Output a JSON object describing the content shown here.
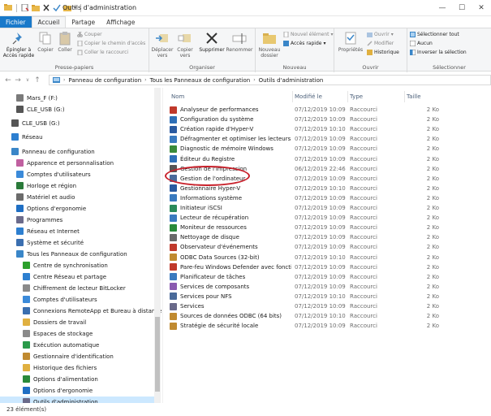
{
  "window": {
    "title": "Outils d'administration",
    "controls": [
      "—",
      "☐",
      "✕"
    ]
  },
  "tabs": [
    "Fichier",
    "Accueil",
    "Partage",
    "Affichage"
  ],
  "ribbon": {
    "presse_papiers": {
      "label": "Presse-papiers",
      "pin": "Épingler à\nAccès rapide",
      "copy": "Copier",
      "paste": "Coller",
      "cut": "Couper",
      "copy_path": "Copier le chemin d'accès",
      "paste_shortcut": "Coller le raccourci"
    },
    "organiser": {
      "label": "Organiser",
      "move": "Déplacer\nvers",
      "copy_to": "Copier\nvers",
      "delete": "Supprimer",
      "rename": "Renommer"
    },
    "nouveau": {
      "label": "Nouveau",
      "new_folder": "Nouveau\ndossier",
      "new_item": "Nouvel élément",
      "easy_access": "Accès rapide"
    },
    "ouvrir": {
      "label": "Ouvrir",
      "properties": "Propriétés",
      "open": "Ouvrir",
      "edit": "Modifier",
      "history": "Historique"
    },
    "selectionner": {
      "label": "Sélectionner",
      "select_all": "Sélectionner tout",
      "select_none": "Aucun",
      "invert": "Inverser la sélection"
    }
  },
  "address": {
    "crumbs": [
      "Panneau de configuration",
      "Tous les Panneaux de configuration",
      "Outils d'administration"
    ]
  },
  "nav": [
    {
      "label": "Mars_F (F:)",
      "indent": 20,
      "icon": "drive",
      "color": "#7a7a7a"
    },
    {
      "label": "CLE_USB (G:)",
      "indent": 20,
      "icon": "usb-drive",
      "color": "#555555"
    },
    {
      "label": "CLE_USB (G:)",
      "indent": 14,
      "icon": "usb-drive",
      "color": "#555555"
    },
    {
      "label": "Réseau",
      "indent": 14,
      "icon": "network",
      "color": "#2d7fd0"
    },
    {
      "label": "Panneau de configuration",
      "indent": 14,
      "icon": "control-panel",
      "color": "#3a86c8"
    },
    {
      "label": "Apparence et personnalisation",
      "indent": 20,
      "icon": "appearance",
      "color": "#c060a0"
    },
    {
      "label": "Comptes d'utilisateurs",
      "indent": 20,
      "icon": "users",
      "color": "#3b8ad9"
    },
    {
      "label": "Horloge et région",
      "indent": 20,
      "icon": "clock",
      "color": "#2a7a3a"
    },
    {
      "label": "Matériel et audio",
      "indent": 20,
      "icon": "hardware",
      "color": "#6b6b6b"
    },
    {
      "label": "Options d'ergonomie",
      "indent": 20,
      "icon": "ease-of-access",
      "color": "#1f6fc4"
    },
    {
      "label": "Programmes",
      "indent": 20,
      "icon": "programs",
      "color": "#6b6b8b"
    },
    {
      "label": "Réseau et Internet",
      "indent": 20,
      "icon": "network-internet",
      "color": "#2d7fd0"
    },
    {
      "label": "Système et sécurité",
      "indent": 20,
      "icon": "system-security",
      "color": "#3b6fb0"
    },
    {
      "label": "Tous les Panneaux de configuration",
      "indent": 20,
      "icon": "control-panel",
      "color": "#3a86c8"
    },
    {
      "label": "Centre de synchronisation",
      "indent": 28,
      "icon": "sync",
      "color": "#2ca02c"
    },
    {
      "label": "Centre Réseau et partage",
      "indent": 28,
      "icon": "network-sharing",
      "color": "#2d7fd0"
    },
    {
      "label": "Chiffrement de lecteur BitLocker",
      "indent": 28,
      "icon": "bitlocker",
      "color": "#8a8a8a"
    },
    {
      "label": "Comptes d'utilisateurs",
      "indent": 28,
      "icon": "users",
      "color": "#3b8ad9"
    },
    {
      "label": "Connexions RemoteApp et Bureau à distance",
      "indent": 28,
      "icon": "remoteapp",
      "color": "#3a6fb0"
    },
    {
      "label": "Dossiers de travail",
      "indent": 28,
      "icon": "work-folders",
      "color": "#e0b040"
    },
    {
      "label": "Espaces de stockage",
      "indent": 28,
      "icon": "storage-spaces",
      "color": "#8a8a8a"
    },
    {
      "label": "Exécution automatique",
      "indent": 28,
      "icon": "autoplay",
      "color": "#2a9a4a"
    },
    {
      "label": "Gestionnaire d'identification",
      "indent": 28,
      "icon": "credential-manager",
      "color": "#c08a30"
    },
    {
      "label": "Historique des fichiers",
      "indent": 28,
      "icon": "file-history",
      "color": "#e0b040"
    },
    {
      "label": "Options d'alimentation",
      "indent": 28,
      "icon": "power",
      "color": "#2a8a3a"
    },
    {
      "label": "Options d'ergonomie",
      "indent": 28,
      "icon": "ease-of-access",
      "color": "#1f6fc4"
    },
    {
      "label": "Outils d'administration",
      "indent": 28,
      "icon": "admin-tools",
      "color": "#6a6a8a",
      "selected": true
    }
  ],
  "columns": {
    "name": "Nom",
    "date": "Modifié le",
    "type": "Type",
    "size": "Taille"
  },
  "files": [
    {
      "name": "Analyseur de performances",
      "date": "07/12/2019 10:09",
      "type": "Raccourci",
      "size": "2 Ko",
      "icon": "perfmon",
      "color": "#c0392b"
    },
    {
      "name": "Configuration du système",
      "date": "07/12/2019 10:09",
      "type": "Raccourci",
      "size": "2 Ko",
      "icon": "msconfig",
      "color": "#2e6fb7"
    },
    {
      "name": "Création rapide d'Hyper-V",
      "date": "07/12/2019 10:10",
      "type": "Raccourci",
      "size": "2 Ko",
      "icon": "hyperv",
      "color": "#2a5aa0"
    },
    {
      "name": "Défragmenter et optimiser les lecteurs",
      "date": "07/12/2019 10:09",
      "type": "Raccourci",
      "size": "2 Ko",
      "icon": "defrag",
      "color": "#3a7abf"
    },
    {
      "name": "Diagnostic de mémoire Windows",
      "date": "07/12/2019 10:09",
      "type": "Raccourci",
      "size": "2 Ko",
      "icon": "memory-diagnostic",
      "color": "#3a8a3a"
    },
    {
      "name": "Éditeur du Registre",
      "date": "07/12/2019 10:09",
      "type": "Raccourci",
      "size": "2 Ko",
      "icon": "regedit",
      "color": "#2e6fb7"
    },
    {
      "name": "Gestion de l'impression",
      "date": "06/12/2019 22:46",
      "type": "Raccourci",
      "size": "2 Ko",
      "icon": "print-management",
      "color": "#555555"
    },
    {
      "name": "Gestion de l'ordinateur",
      "date": "07/12/2019 10:09",
      "type": "Raccourci",
      "size": "2 Ko",
      "icon": "computer-management",
      "color": "#4a6a9a"
    },
    {
      "name": "Gestionnaire Hyper-V",
      "date": "07/12/2019 10:10",
      "type": "Raccourci",
      "size": "2 Ko",
      "icon": "hyperv",
      "color": "#2a5aa0"
    },
    {
      "name": "Informations système",
      "date": "07/12/2019 10:09",
      "type": "Raccourci",
      "size": "2 Ko",
      "icon": "system-info",
      "color": "#3a7abf"
    },
    {
      "name": "Initiateur iSCSI",
      "date": "07/12/2019 10:09",
      "type": "Raccourci",
      "size": "2 Ko",
      "icon": "iscsi",
      "color": "#2a8a5a"
    },
    {
      "name": "Lecteur de récupération",
      "date": "07/12/2019 10:09",
      "type": "Raccourci",
      "size": "2 Ko",
      "icon": "recovery-drive",
      "color": "#3a7abf"
    },
    {
      "name": "Moniteur de ressources",
      "date": "07/12/2019 10:09",
      "type": "Raccourci",
      "size": "2 Ko",
      "icon": "resmon",
      "color": "#2a8a3a"
    },
    {
      "name": "Nettoyage de disque",
      "date": "07/12/2019 10:09",
      "type": "Raccourci",
      "size": "2 Ko",
      "icon": "disk-cleanup",
      "color": "#6a6a6a"
    },
    {
      "name": "Observateur d'événements",
      "date": "07/12/2019 10:09",
      "type": "Raccourci",
      "size": "2 Ko",
      "icon": "event-viewer",
      "color": "#c0392b"
    },
    {
      "name": "ODBC Data Sources (32-bit)",
      "date": "07/12/2019 10:10",
      "type": "Raccourci",
      "size": "2 Ko",
      "icon": "odbc",
      "color": "#c08a30"
    },
    {
      "name": "Pare-feu Windows Defender avec fonctio...",
      "date": "07/12/2019 10:09",
      "type": "Raccourci",
      "size": "2 Ko",
      "icon": "firewall",
      "color": "#c0392b"
    },
    {
      "name": "Planificateur de tâches",
      "date": "07/12/2019 10:09",
      "type": "Raccourci",
      "size": "2 Ko",
      "icon": "task-scheduler",
      "color": "#3a7abf"
    },
    {
      "name": "Services de composants",
      "date": "07/12/2019 10:09",
      "type": "Raccourci",
      "size": "2 Ko",
      "icon": "component-services",
      "color": "#8a5ab0"
    },
    {
      "name": "Services pour NFS",
      "date": "07/12/2019 10:10",
      "type": "Raccourci",
      "size": "2 Ko",
      "icon": "nfs",
      "color": "#4a6a9a"
    },
    {
      "name": "Services",
      "date": "07/12/2019 10:09",
      "type": "Raccourci",
      "size": "2 Ko",
      "icon": "services",
      "color": "#6a6a8a"
    },
    {
      "name": "Sources de données ODBC (64 bits)",
      "date": "07/12/2019 10:10",
      "type": "Raccourci",
      "size": "2 Ko",
      "icon": "odbc",
      "color": "#c08a30"
    },
    {
      "name": "Stratégie de sécurité locale",
      "date": "07/12/2019 10:09",
      "type": "Raccourci",
      "size": "2 Ko",
      "icon": "security-policy",
      "color": "#c08a30"
    }
  ],
  "status": {
    "count": "23 élément(s)"
  },
  "colors": {
    "file_tab": "#1979ca",
    "selection": "#cce8ff",
    "highlight_circle": "#c8202a"
  }
}
